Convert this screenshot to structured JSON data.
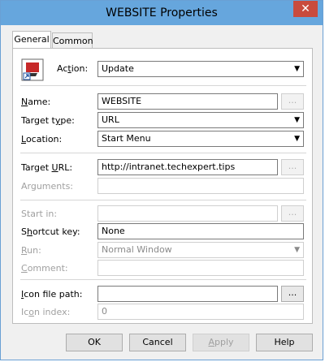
{
  "window": {
    "title": "WEBSITE Properties",
    "close_glyph": "✕"
  },
  "tabs": [
    {
      "label": "General",
      "active": true
    },
    {
      "label": "Common",
      "active": false
    }
  ],
  "general": {
    "action": {
      "label": "Action:",
      "value": "Update"
    },
    "name": {
      "label": "Name:",
      "value": "WEBSITE"
    },
    "target_type": {
      "label": "Target type:",
      "value": "URL"
    },
    "location": {
      "label": "Location:",
      "value": "Start Menu"
    },
    "target_url": {
      "label": "Target URL:",
      "value": "http://intranet.techexpert.tips"
    },
    "arguments": {
      "label": "Arguments:",
      "value": ""
    },
    "start_in": {
      "label": "Start in:",
      "value": ""
    },
    "shortcut_key": {
      "label": "Shortcut key:",
      "value": "None"
    },
    "run": {
      "label": "Run:",
      "value": "Normal Window"
    },
    "comment": {
      "label": "Comment:",
      "value": ""
    },
    "icon_file_path": {
      "label": "Icon file path:",
      "value": ""
    },
    "icon_index": {
      "label": "Icon index:",
      "value": "0"
    },
    "browse_label": "..."
  },
  "buttons": {
    "ok": "OK",
    "cancel": "Cancel",
    "apply": "Apply",
    "help": "Help"
  }
}
